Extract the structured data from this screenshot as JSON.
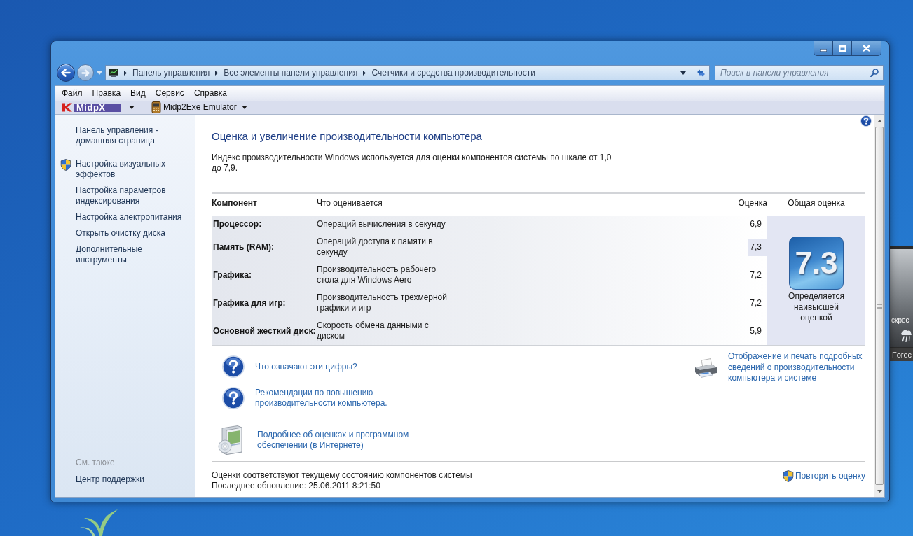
{
  "address_bar": {
    "breadcrumb": [
      "Панель управления",
      "Все элементы панели управления",
      "Счетчики и средства производительности"
    ]
  },
  "search": {
    "placeholder": "Поиск в панели управления"
  },
  "menu": [
    "Файл",
    "Правка",
    "Вид",
    "Сервис",
    "Справка"
  ],
  "toolbar": [
    {
      "kind": "logo",
      "label": "MidpX"
    },
    {
      "kind": "app",
      "label": "Midp2Exe Emulator"
    }
  ],
  "sidebar": {
    "home": "Панель управления - домашняя страница",
    "tasks": [
      {
        "label": "Настройка визуальных эффектов",
        "shield": true
      },
      {
        "label": "Настройка параметров индексирования",
        "shield": false
      },
      {
        "label": "Настройка электропитания",
        "shield": false
      },
      {
        "label": "Открыть очистку диска",
        "shield": false
      },
      {
        "label": "Дополнительные инструменты",
        "shield": false
      }
    ],
    "see_also": {
      "title": "См. также",
      "links": [
        "Центр поддержки"
      ]
    }
  },
  "main": {
    "title": "Оценка и увеличение производительности компьютера",
    "description": "Индекс производительности Windows используется для оценки компонентов системы по шкале от 1,0 до 7,9."
  },
  "assessment": {
    "columns": [
      "Компонент",
      "Что оценивается",
      "Оценка",
      "Общая оценка"
    ],
    "rows": [
      {
        "component": "Процессор:",
        "measure": "Операций вычисления в секунду",
        "score": "6,9",
        "highlighted": false
      },
      {
        "component": "Память (RAM):",
        "measure": "Операций доступа к памяти в секунду",
        "score": "7,3",
        "highlighted": true
      },
      {
        "component": "Графика:",
        "measure": "Производительность рабочего стола для Windows Aero",
        "score": "7,2",
        "highlighted": false
      },
      {
        "component": "Графика для игр:",
        "measure": "Производительность трехмерной графики и игр",
        "score": "7,2",
        "highlighted": false
      },
      {
        "component": "Основной жесткий диск:",
        "measure": "Скорость обмена данными с диском",
        "score": "5,9",
        "highlighted": false
      }
    ],
    "base_score": {
      "value": "7.3",
      "caption": "Определяется наивысшей оценкой"
    }
  },
  "links": [
    {
      "kind": "help",
      "label": "Что означают эти цифры?"
    },
    {
      "kind": "help",
      "label": "Рекомендации по повышению производительности компьютера."
    },
    {
      "kind": "print",
      "label": "Отображение и печать подробных сведений о производительности компьютера и системе"
    }
  ],
  "info_box": {
    "label": "Подробнее об оценках и программном обеспечении (в Интернете)"
  },
  "footer": {
    "status": "Оценки соответствуют текущему состоянию компонентов системы",
    "updated": "Последнее обновление: 25.06.2011 8:21:50",
    "rerun": "Повторить оценку"
  },
  "desktop_gadget": {
    "label": "скрес",
    "footer": "Forec"
  }
}
